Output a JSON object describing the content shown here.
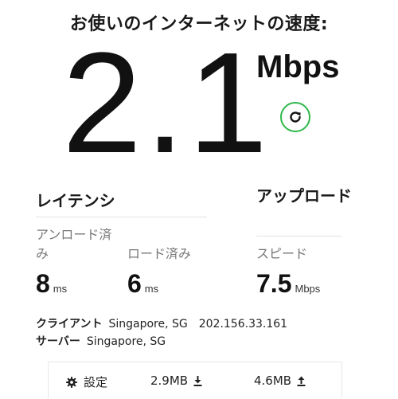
{
  "header": {
    "title": "お使いのインターネットの速度:"
  },
  "speed": {
    "value": "2.1",
    "unit": "Mbps"
  },
  "latency": {
    "title": "レイテンシ",
    "unloaded_label": "アンロード済み",
    "unloaded_value": "8",
    "unloaded_unit": "ms",
    "loaded_label": "ロード済み",
    "loaded_value": "6",
    "loaded_unit": "ms"
  },
  "upload": {
    "title": "アップロード",
    "speed_label": "スピード",
    "value": "7.5",
    "unit": "Mbps"
  },
  "client": {
    "label": "クライアント",
    "location": "Singapore, SG",
    "ip": "202.156.33.161"
  },
  "server": {
    "label": "サーバー",
    "location": "Singapore, SG"
  },
  "footer": {
    "settings_label": "設定",
    "download_size": "2.9MB",
    "upload_size": "4.6MB"
  },
  "colors": {
    "accent": "#2fb84a",
    "text": "#1a1a1a",
    "muted": "#777777",
    "divider": "#e3e3e3"
  },
  "icons": {
    "refresh": "refresh-icon",
    "settings": "gear-icon",
    "download": "download-arrow-icon",
    "upload": "upload-arrow-icon"
  }
}
